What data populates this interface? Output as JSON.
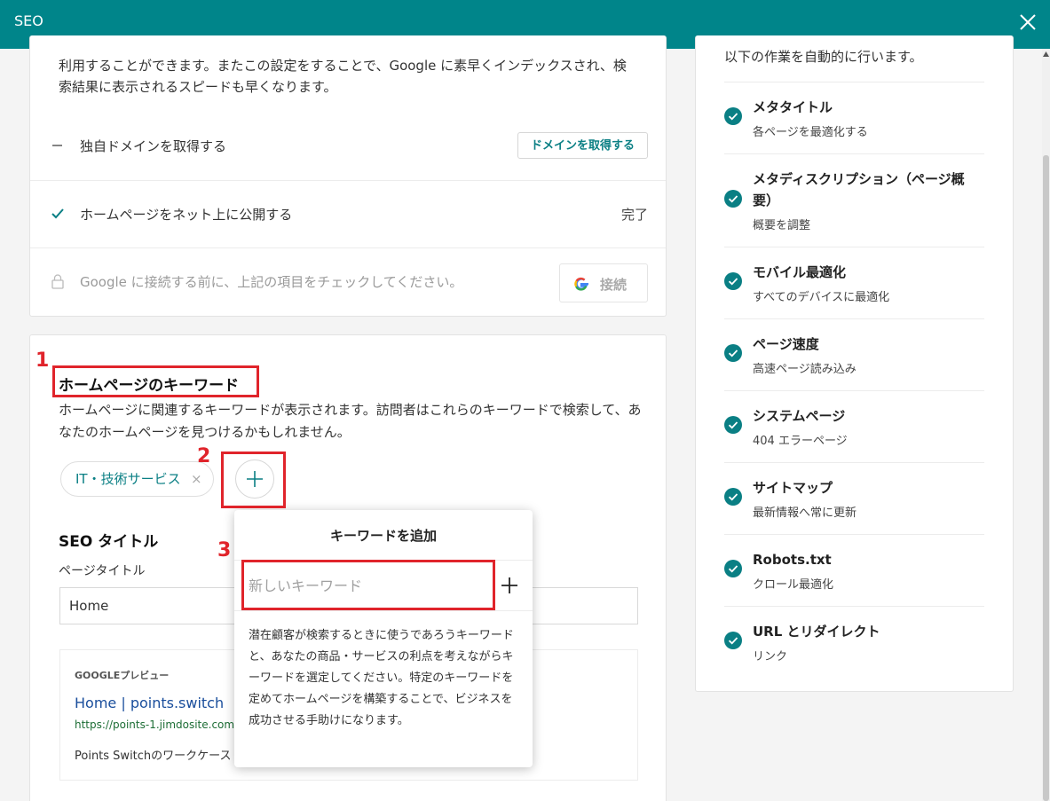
{
  "header": {
    "title": "SEO"
  },
  "card1": {
    "intro": "利用することができます。またこの設定をすることで、Google に素早くインデックスされ、検索結果に表示されるスピードも早くなります。",
    "rows": [
      {
        "label": "独自ドメインを取得する",
        "button": "ドメインを取得する"
      },
      {
        "label": "ホームページをネット上に公開する",
        "status": "完了"
      },
      {
        "label": "Google に接続する前に、上記の項目をチェックしてください。",
        "button": "接続"
      }
    ]
  },
  "keywords": {
    "heading": "ホームページのキーワード",
    "description": "ホームページに関連するキーワードが表示されます。訪問者はこれらのキーワードで検索して、あなたのホームページを見つけるかもしれません。",
    "chips": [
      {
        "label": "IT・技術サービス",
        "remove": "×"
      }
    ]
  },
  "seo": {
    "heading": "SEO タイトル",
    "page_title_label": "ページタイトル",
    "page_title_value": "Home"
  },
  "preview": {
    "label": "GOOGLEプレビュー",
    "title": "Home | points.switch",
    "url": "https://points-1.jimdosite.com",
    "desc": "Points Switchのワークケース"
  },
  "popup": {
    "title": "キーワードを追加",
    "placeholder": "新しいキーワード",
    "description": "潜在顧客が検索するときに使うであろうキーワードと、あなたの商品・サービスの利点を考えながらキーワードを選定してください。特定のキーワードを定めてホームページを構築することで、ビジネスを成功させる手助けになります。"
  },
  "annotations": {
    "n1": "1",
    "n2": "2",
    "n3": "3"
  },
  "sidebar": {
    "intro": "以下の作業を自動的に行います。",
    "items": [
      {
        "title": "メタタイトル",
        "sub": "各ページを最適化する"
      },
      {
        "title": "メタディスクリプション（ページ概要）",
        "sub": "概要を調整"
      },
      {
        "title": "モバイル最適化",
        "sub": "すべてのデバイスに最適化"
      },
      {
        "title": "ページ速度",
        "sub": "高速ページ読み込み"
      },
      {
        "title": "システムページ",
        "sub": "404 エラーページ"
      },
      {
        "title": "サイトマップ",
        "sub": "最新情報へ常に更新"
      },
      {
        "title": "Robots.txt",
        "sub": "クロール最適化"
      },
      {
        "title": "URL とリダイレクト",
        "sub": "リンク"
      }
    ]
  },
  "colors": {
    "header": "#00858a",
    "accent": "#0a7f84",
    "highlight": "#e0242b"
  }
}
